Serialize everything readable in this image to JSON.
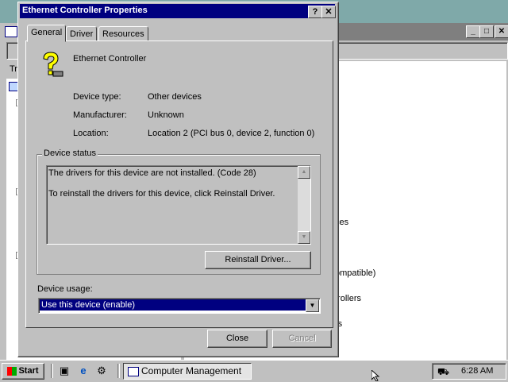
{
  "dialog": {
    "title": "Ethernet Controller Properties",
    "help_button": "?",
    "close_button": "✕",
    "tabs": [
      {
        "label": "General",
        "active": true
      },
      {
        "label": "Driver",
        "active": false
      },
      {
        "label": "Resources",
        "active": false
      }
    ],
    "device_name": "Ethernet Controller",
    "fields": [
      {
        "label": "Device type:",
        "value": "Other devices"
      },
      {
        "label": "Manufacturer:",
        "value": "Unknown"
      },
      {
        "label": "Location:",
        "value": "Location 2 (PCI bus 0, device 2, function 0)"
      }
    ],
    "device_status": {
      "legend": "Device status",
      "line1": "The drivers for this device are not installed. (Code 28)",
      "line2": "To reinstall the drivers for this device, click Reinstall Driver."
    },
    "reinstall_button": "Reinstall Driver...",
    "device_usage": {
      "label": "Device usage:",
      "selected": "Use this device (enable)"
    },
    "close_label": "Close",
    "cancel_label": "Cancel"
  },
  "background_window": {
    "partial_text": [
      "Tr",
      "ces",
      "ompatible)",
      "trollers",
      "rs"
    ]
  },
  "taskbar": {
    "start_label": "Start",
    "task_label": "Computer Management",
    "clock": "6:28 AM"
  },
  "colors": {
    "title_active": "#000080",
    "title_inactive": "#7f7f7f",
    "face": "#c0c0c0",
    "desktop": "#7fa9a9"
  }
}
